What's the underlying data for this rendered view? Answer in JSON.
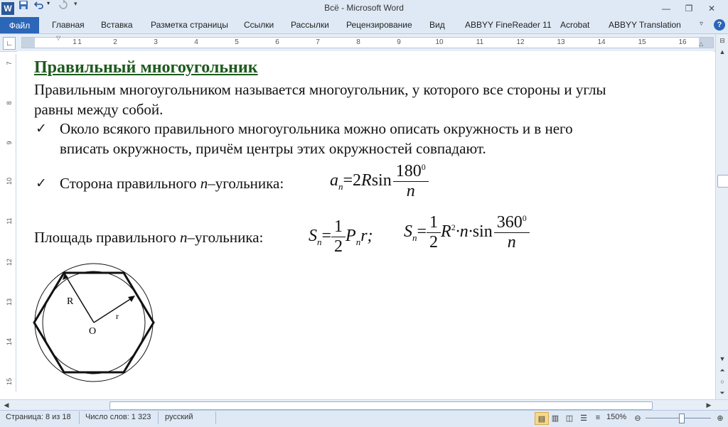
{
  "window": {
    "title": "Всё  -  Microsoft Word"
  },
  "quick_access": {
    "save_icon": "save-icon",
    "undo_icon": "undo-icon",
    "redo_icon": "redo-icon"
  },
  "ribbon": {
    "file_tab": "Файл",
    "tabs": [
      "Главная",
      "Вставка",
      "Разметка страницы",
      "Ссылки",
      "Рассылки",
      "Рецензирование",
      "Вид",
      "ABBYY FineReader 11",
      "Acrobat",
      "ABBYY Translation"
    ]
  },
  "ruler": {
    "h_numbers": [
      "1",
      "1",
      "2",
      "3",
      "4",
      "5",
      "6",
      "7",
      "8",
      "9",
      "10",
      "11",
      "12",
      "13",
      "14",
      "15",
      "16"
    ],
    "v_numbers": [
      "7",
      "8",
      "9",
      "10",
      "11",
      "12",
      "13",
      "14",
      "15"
    ]
  },
  "document": {
    "heading": "Правильный многоугольник",
    "para1_line1": "Правильным многоугольником называется многоугольник, у которого все стороны и углы",
    "para1_line2": "равны между собой.",
    "bullet1_line1": "Около всякого правильного многоугольника можно описать окружность и в него",
    "bullet1_line2": "вписать окружность, причём центры этих окружностей совпадают.",
    "bullet2_text": "Сторона правильного ",
    "bullet2_n": "n",
    "bullet2_rest": "–угольника:",
    "formula1": {
      "lhs": "a",
      "sub": "n",
      "eq": "=2",
      "R": "R",
      "sin": "sin",
      "num": "180",
      "sup": "0",
      "den": "n"
    },
    "area_text": "Площадь правильного ",
    "area_n": "n",
    "area_rest": "–угольника:",
    "formula2": {
      "S": "S",
      "sub": "n",
      "eq": "=",
      "num": "1",
      "den": "2",
      "P": "P",
      "r": "r;"
    },
    "formula3": {
      "S": "S",
      "sub": "n",
      "eq": "=",
      "num": "1",
      "den": "2",
      "R": "R",
      "sup2": "2",
      "dot_n": "·n·",
      "sin": "sin",
      "num2": "360",
      "sup0": "0",
      "den2": "n"
    },
    "figure": {
      "label_R": "R",
      "label_r": "r",
      "label_O": "O"
    }
  },
  "status": {
    "page": "Страница: 8 из 18",
    "words": "Число слов: 1 323",
    "lang": "русский",
    "zoom": "150%"
  }
}
